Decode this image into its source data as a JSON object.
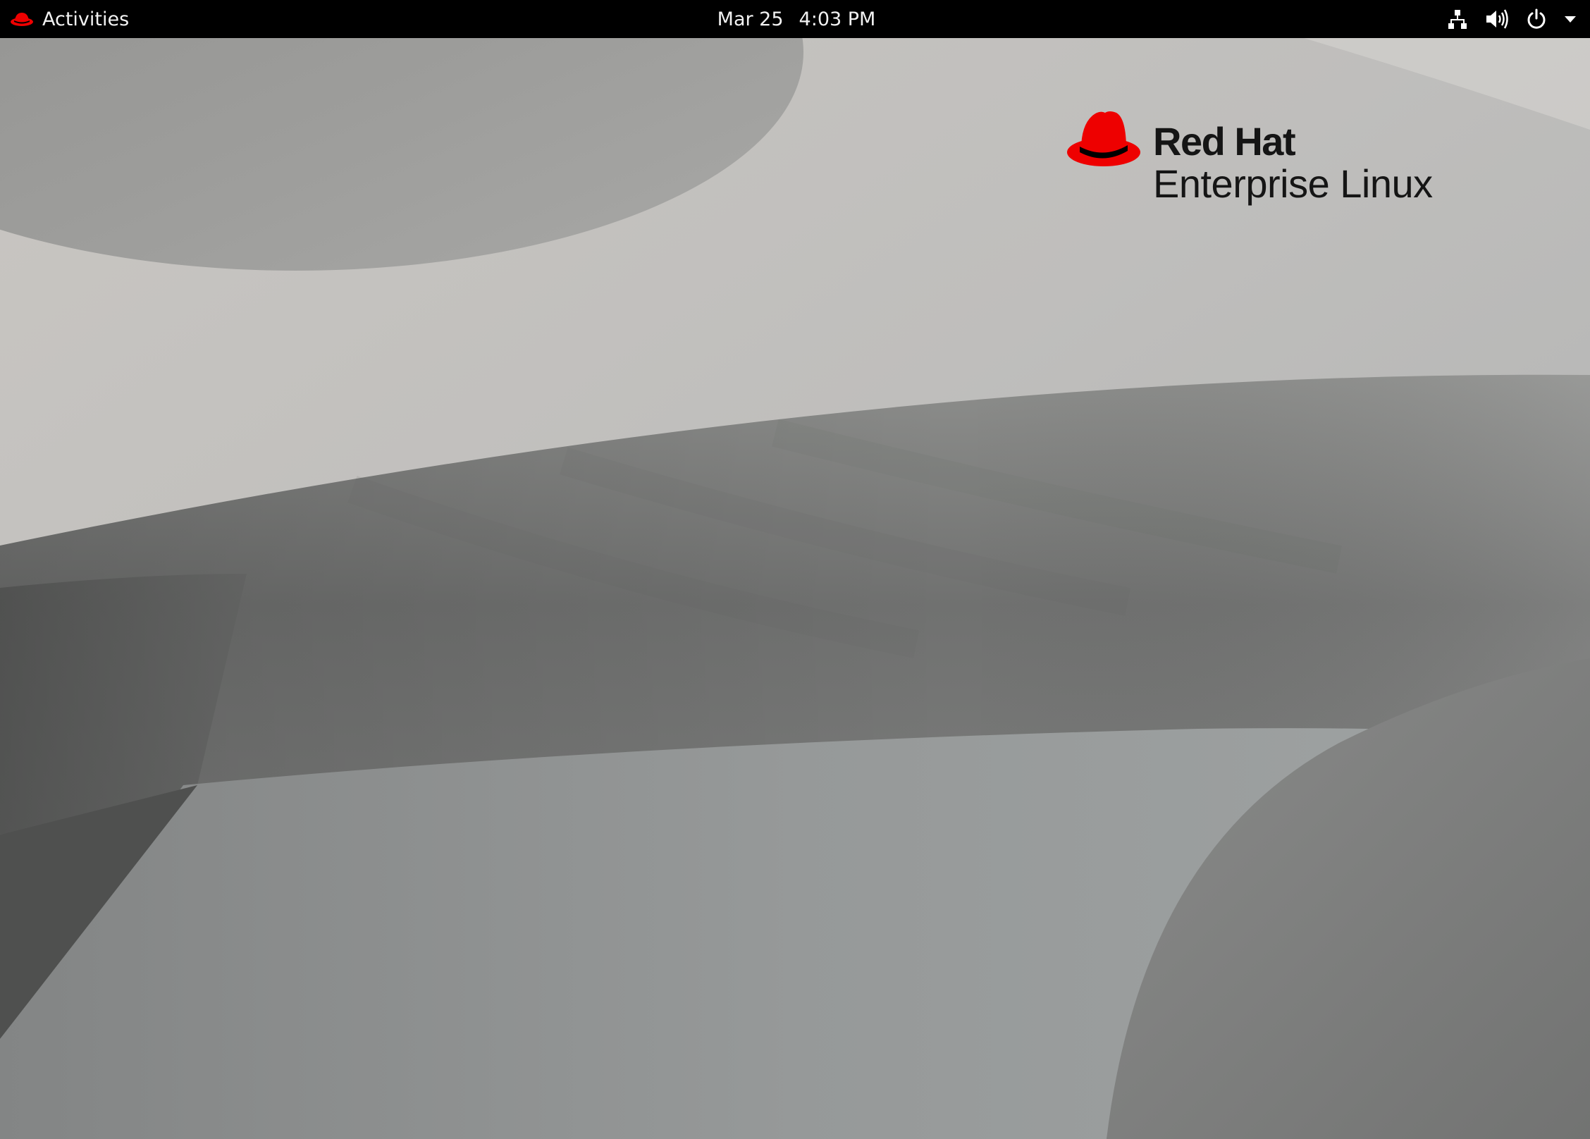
{
  "top_bar": {
    "activities_label": "Activities",
    "date": "Mar 25",
    "time": "4:03 PM",
    "tray_icons": [
      "network-wired-icon",
      "volume-icon",
      "power-icon",
      "dropdown-arrow-icon"
    ]
  },
  "desktop": {
    "brand": {
      "line1": "Red Hat",
      "line2": "Enterprise Linux"
    }
  },
  "colors": {
    "top_bar_bg": "#000000",
    "brand_red": "#ee0000",
    "brand_text": "#151515"
  }
}
